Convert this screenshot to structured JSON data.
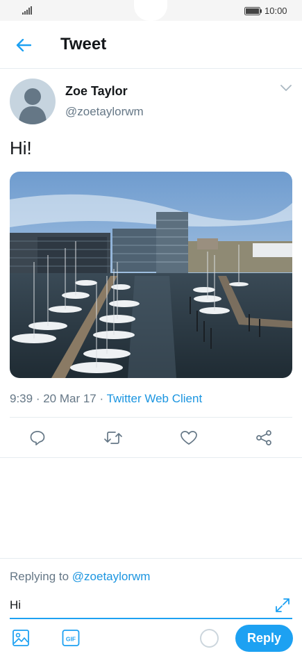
{
  "status_bar": {
    "time": "10:00"
  },
  "header": {
    "title": "Tweet",
    "back_icon": "arrow-left-icon"
  },
  "tweet": {
    "author_name": "Zoe Taylor",
    "author_handle": "@zoetaylorwm",
    "text": "Hi!",
    "time": "9:39",
    "separator1": " · ",
    "date": "20 Mar 17",
    "separator2": " · ",
    "source": "Twitter Web Client"
  },
  "actions": [
    "reply-icon",
    "retweet-icon",
    "like-icon",
    "share-icon"
  ],
  "composer": {
    "replying_prefix": "Replying to ",
    "replying_handle": "@zoetaylorwm",
    "value": "Hi",
    "reply_label": "Reply",
    "gif_label": "GIF"
  },
  "colors": {
    "accent": "#1da1f2",
    "link": "#1b95e0",
    "muted": "#657786"
  }
}
